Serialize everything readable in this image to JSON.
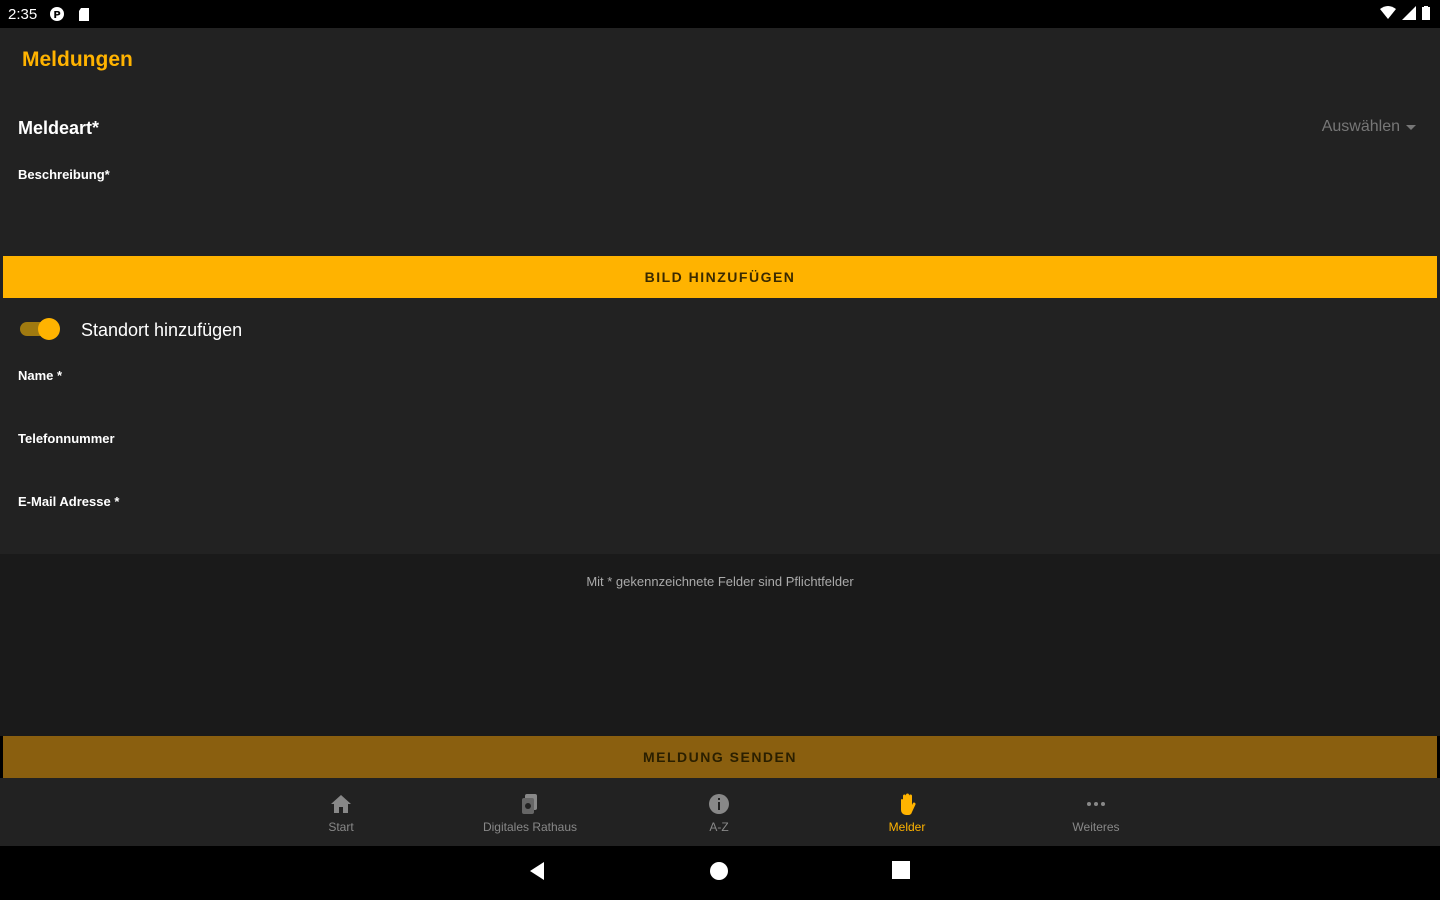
{
  "status_bar": {
    "time": "2:35"
  },
  "app_bar": {
    "title": "Meldungen"
  },
  "form": {
    "meldeart_label": "Meldeart*",
    "meldeart_select": "Auswählen",
    "beschreibung_label": "Beschreibung*",
    "add_image_button": "BILD HINZUFÜGEN",
    "location_toggle_label": "Standort hinzufügen",
    "location_toggle_on": true,
    "name_label": "Name *",
    "phone_label": "Telefonnummer",
    "email_label": "E-Mail Adresse *"
  },
  "hint": "Mit * gekennzeichnete Felder sind Pflichtfelder",
  "send_button": "MELDUNG SENDEN",
  "bottom_nav": {
    "items": [
      {
        "label": "Start",
        "icon": "home-icon",
        "active": false
      },
      {
        "label": "Digitales Rathaus",
        "icon": "documents-icon",
        "active": false
      },
      {
        "label": "A-Z",
        "icon": "info-icon",
        "active": false
      },
      {
        "label": "Melder",
        "icon": "hand-icon",
        "active": true
      },
      {
        "label": "Weiteres",
        "icon": "more-icon",
        "active": false
      }
    ]
  },
  "colors": {
    "accent": "#ffb300",
    "accent_dim": "#8a5f0f",
    "background": "#222222"
  }
}
